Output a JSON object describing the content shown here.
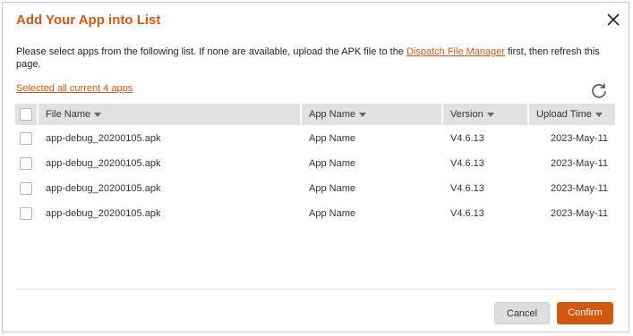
{
  "dialog": {
    "title": "Add Your App into List",
    "description_prefix": "Please select apps from the following list. If none are available, upload the APK file to the ",
    "description_link": "Dispatch File Manager",
    "description_suffix": " first, then refresh this page.",
    "select_all_link": "Selected all current 4 apps"
  },
  "table": {
    "columns": [
      "File Name",
      "App Name",
      "Version",
      "Upload Time"
    ],
    "rows": [
      {
        "file_name": "app-debug_20200105.apk",
        "app_name": "App Name",
        "version": "V4.6.13",
        "upload_time": "2023-May-11"
      },
      {
        "file_name": "app-debug_20200105.apk",
        "app_name": "App Name",
        "version": "V4.6.13",
        "upload_time": "2023-May-11"
      },
      {
        "file_name": "app-debug_20200105.apk",
        "app_name": "App Name",
        "version": "V4.6.13",
        "upload_time": "2023-May-11"
      },
      {
        "file_name": "app-debug_20200105.apk",
        "app_name": "App Name",
        "version": "V4.6.13",
        "upload_time": "2023-May-11"
      }
    ]
  },
  "buttons": {
    "cancel": "Cancel",
    "confirm": "Confirm"
  },
  "colors": {
    "accent": "#d4570f",
    "header_bg": "#e1e1e1"
  },
  "icons": {
    "close": "close-icon",
    "refresh": "refresh-icon",
    "sort": "caret-down-icon"
  }
}
